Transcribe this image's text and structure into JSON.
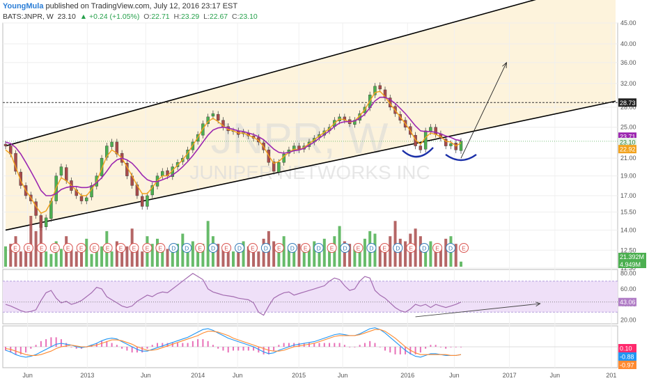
{
  "header": {
    "author": "YoungMula",
    "published": "published on TradingView.com, July 12, 2016 23:17 EST",
    "symbol": "BATS:JNPR, W",
    "last": "23.10",
    "change": "▲ +0.24 (+1.05%)",
    "open_label": "O:",
    "open": "22.71",
    "high_label": "H:",
    "high": "23.29",
    "low_label": "L:",
    "low": "22.67",
    "close_label": "C:",
    "close": "23.10"
  },
  "watermark": {
    "symbol": "JNPR, W",
    "company": "JUNIPER NETWORKS INC"
  },
  "colors": {
    "up": "#4caf50",
    "down": "#a84b4b",
    "ema": "#f2a21c",
    "sma": "#9c27b0",
    "channel_fill": "#fdf2d8",
    "rsi": "#a36bb0",
    "rsi_band": "#efe0f8",
    "macd": "#2196f3",
    "signal": "#ff8a30",
    "hist": "#e040a0",
    "arc": "#1a2fa8"
  },
  "chart_data": [
    {
      "type": "candlestick",
      "panel": "price",
      "x_ticks": [
        "Jun",
        "2013",
        "Jun",
        "2014",
        "Jun",
        "2015",
        "Jun",
        "2016",
        "Jun",
        "2017",
        "Jun",
        "201"
      ],
      "y_ticks": [
        "45.00",
        "40.00",
        "36.00",
        "32.00",
        "28.00",
        "25.00",
        "21.00",
        "19.00",
        "17.00",
        "15.50",
        "14.00",
        "12.50",
        "11.30"
      ],
      "ylim": [
        11.3,
        45
      ],
      "y_scale": "log",
      "series": [
        {
          "name": "Price",
          "values": [
            22.5,
            21.5,
            19.5,
            18.0,
            17.0,
            16.5,
            15.2,
            14.2,
            15.0,
            16.5,
            19.0,
            20.0,
            18.5,
            17.5,
            17.0,
            16.5,
            16.8,
            18.0,
            19.0,
            21.0,
            22.5,
            23.0,
            21.5,
            20.5,
            19.0,
            18.0,
            17.0,
            16.0,
            17.0,
            18.0,
            19.0,
            19.5,
            19.0,
            20.0,
            20.5,
            21.0,
            22.0,
            23.0,
            24.0,
            25.5,
            26.5,
            27.0,
            26.0,
            25.0,
            24.5,
            24.5,
            24.0,
            24.3,
            23.8,
            23.5,
            23.0,
            22.0,
            20.5,
            19.5,
            20.5,
            21.5,
            22.0,
            22.5,
            22.0,
            22.5,
            23.0,
            23.5,
            24.0,
            24.5,
            25.0,
            26.0,
            26.5,
            26.0,
            25.5,
            26.0,
            27.0,
            28.0,
            30.0,
            31.5,
            31.0,
            29.5,
            28.0,
            27.0,
            26.0,
            25.0,
            24.0,
            22.5,
            22.0,
            24.5,
            25.0,
            24.0,
            23.5,
            22.5,
            22.8,
            22.0,
            23.1
          ]
        },
        {
          "name": "EMA",
          "values": [
            22.0,
            21.5,
            20.0,
            18.5,
            17.5,
            16.8,
            16.0,
            15.4,
            15.6,
            16.4,
            17.8,
            18.8,
            18.5,
            18.0,
            17.5,
            17.0,
            17.0,
            17.6,
            18.4,
            19.8,
            21.2,
            22.0,
            21.6,
            21.0,
            20.0,
            19.0,
            18.0,
            17.2,
            17.2,
            17.8,
            18.5,
            19.0,
            19.0,
            19.6,
            20.2,
            20.8,
            21.6,
            22.6,
            23.6,
            24.8,
            25.8,
            26.3,
            25.8,
            25.2,
            24.7,
            24.5,
            24.2,
            24.2,
            23.9,
            23.6,
            23.2,
            22.4,
            21.3,
            20.4,
            20.6,
            21.2,
            21.7,
            22.1,
            22.0,
            22.3,
            22.8,
            23.3,
            23.8,
            24.3,
            24.8,
            25.6,
            26.2,
            26.1,
            25.7,
            25.9,
            26.7,
            27.6,
            29.0,
            30.4,
            30.6,
            29.7,
            28.5,
            27.5,
            26.5,
            25.5,
            24.5,
            23.3,
            22.7,
            23.6,
            24.2,
            24.0,
            23.7,
            23.1,
            23.0,
            22.5,
            22.9
          ]
        },
        {
          "name": "SMA",
          "values": [
            23.0,
            22.8,
            22.3,
            21.5,
            20.5,
            19.5,
            18.5,
            17.5,
            17.0,
            17.0,
            17.2,
            17.6,
            17.8,
            17.9,
            17.9,
            17.8,
            17.8,
            17.9,
            18.3,
            18.8,
            19.5,
            20.3,
            20.8,
            21.0,
            20.8,
            20.4,
            19.8,
            19.1,
            18.6,
            18.4,
            18.4,
            18.6,
            18.8,
            19.1,
            19.5,
            20.0,
            20.6,
            21.3,
            22.1,
            23.0,
            23.9,
            24.6,
            24.9,
            25.0,
            24.9,
            24.7,
            24.5,
            24.4,
            24.2,
            24.0,
            23.7,
            23.3,
            22.7,
            22.1,
            21.7,
            21.6,
            21.7,
            21.9,
            22.0,
            22.2,
            22.6,
            23.0,
            23.5,
            24.0,
            24.5,
            25.1,
            25.6,
            25.8,
            25.8,
            25.9,
            26.3,
            26.9,
            27.9,
            29.0,
            29.6,
            29.6,
            29.2,
            28.6,
            27.8,
            27.0,
            26.1,
            25.2,
            24.5,
            24.4,
            24.4,
            24.3,
            24.1,
            23.8,
            23.6,
            23.3,
            23.2
          ]
        }
      ],
      "price_labels": [
        {
          "text": "45.00"
        },
        {
          "text": "28.73"
        },
        {
          "text": "23.71"
        },
        {
          "text": "23.10"
        },
        {
          "text": "22.92"
        }
      ],
      "horizontal_line": 28.73,
      "channel": {
        "lower": [
          [
            0,
            14.0
          ],
          [
            88,
            23.8
          ],
          [
            100,
            25.6
          ]
        ],
        "upper": [
          [
            0,
            22.5
          ],
          [
            88,
            45.0
          ]
        ],
        "upper_offset_pct": 61
      },
      "arrow": {
        "from": [
          90,
          21.0
        ],
        "to": [
          99,
          36.0
        ]
      },
      "grid": true
    },
    {
      "type": "bar",
      "panel": "volume",
      "y_ticks": [
        "21.392M",
        "4.949M"
      ],
      "values": [
        8,
        9,
        12,
        6,
        7,
        20,
        14,
        18,
        6,
        5,
        10,
        7,
        12,
        8,
        6,
        9,
        11,
        5,
        7,
        8,
        14,
        6,
        10,
        9,
        8,
        15,
        7,
        6,
        12,
        9,
        11,
        8,
        7,
        6,
        9,
        13,
        8,
        10,
        7,
        9,
        18,
        12,
        9,
        8,
        7,
        6,
        9,
        10,
        8,
        7,
        6,
        11,
        14,
        10,
        8,
        12,
        7,
        6,
        9,
        8,
        7,
        10,
        9,
        11,
        8,
        12,
        16,
        10,
        9,
        8,
        7,
        11,
        14,
        13,
        8,
        9,
        12,
        18,
        11,
        10,
        13,
        15,
        12,
        9,
        10,
        8,
        7,
        11,
        12,
        9,
        2
      ],
      "earnings_markers": [
        "E",
        "E",
        "E",
        "E",
        "E",
        "E",
        "E",
        "E",
        "E",
        "E",
        "E",
        "E",
        "D",
        "D",
        "E",
        "D",
        "E",
        "D",
        "E",
        "D",
        "E",
        "D",
        "E",
        "D",
        "E",
        "D",
        "E",
        "D",
        "E",
        "D",
        "E",
        "D",
        "E",
        "D",
        "E"
      ]
    },
    {
      "type": "line",
      "panel": "rsi",
      "name": "RSI",
      "y_ticks": [
        "80.00",
        "60.00",
        "40.00",
        "20.00"
      ],
      "ylim": [
        15,
        85
      ],
      "band": [
        30,
        70
      ],
      "last_label": "43.06",
      "values": [
        40,
        38,
        35,
        32,
        30,
        31,
        33,
        45,
        55,
        58,
        48,
        42,
        44,
        40,
        42,
        45,
        50,
        55,
        62,
        60,
        50,
        46,
        42,
        38,
        36,
        38,
        44,
        48,
        52,
        50,
        54,
        56,
        55,
        60,
        65,
        70,
        75,
        80,
        76,
        72,
        60,
        56,
        54,
        52,
        51,
        50,
        48,
        47,
        46,
        42,
        30,
        26,
        38,
        48,
        52,
        55,
        56,
        52,
        54,
        56,
        58,
        60,
        62,
        64,
        70,
        74,
        72,
        64,
        58,
        60,
        70,
        76,
        74,
        58,
        52,
        48,
        42,
        36,
        32,
        30,
        34,
        40,
        38,
        40,
        36,
        40,
        38,
        36,
        38,
        40,
        43
      ],
      "trendline": {
        "from": [
          81,
          24
        ],
        "to": [
          96,
          41
        ]
      }
    },
    {
      "type": "line",
      "panel": "macd",
      "name": "MACD",
      "last_labels": [
        "0.10",
        "-0.88",
        "-0.97"
      ],
      "series": [
        {
          "name": "MACD",
          "values": [
            -0.4,
            -0.6,
            -0.9,
            -1.1,
            -1.2,
            -1.1,
            -0.9,
            -0.6,
            -0.3,
            0.0,
            0.3,
            0.4,
            0.3,
            0.2,
            0.0,
            -0.1,
            0.0,
            0.2,
            0.4,
            0.7,
            0.9,
            1.0,
            0.9,
            0.6,
            0.3,
            0.0,
            -0.3,
            -0.5,
            -0.5,
            -0.3,
            -0.1,
            0.1,
            0.3,
            0.5,
            0.7,
            0.9,
            1.1,
            1.4,
            1.7,
            2.0,
            2.1,
            1.9,
            1.6,
            1.3,
            1.0,
            0.8,
            0.6,
            0.4,
            0.2,
            0.0,
            -0.3,
            -0.6,
            -0.8,
            -0.7,
            -0.4,
            -0.2,
            0.0,
            0.2,
            0.3,
            0.4,
            0.5,
            0.6,
            0.8,
            1.0,
            1.2,
            1.4,
            1.5,
            1.4,
            1.3,
            1.3,
            1.5,
            1.8,
            2.1,
            2.2,
            2.0,
            1.6,
            1.1,
            0.6,
            0.1,
            -0.4,
            -0.8,
            -1.1,
            -1.2,
            -1.0,
            -0.8,
            -0.8,
            -0.9,
            -1.0,
            -1.0,
            -1.0,
            -0.9
          ]
        },
        {
          "name": "Signal",
          "values": [
            -0.2,
            -0.3,
            -0.5,
            -0.7,
            -0.9,
            -1.0,
            -1.0,
            -0.9,
            -0.7,
            -0.5,
            -0.2,
            0.0,
            0.1,
            0.2,
            0.1,
            0.0,
            0.0,
            0.1,
            0.2,
            0.4,
            0.6,
            0.8,
            0.8,
            0.7,
            0.5,
            0.3,
            0.0,
            -0.2,
            -0.4,
            -0.4,
            -0.3,
            -0.1,
            0.1,
            0.3,
            0.5,
            0.7,
            0.9,
            1.1,
            1.3,
            1.6,
            1.8,
            1.8,
            1.7,
            1.5,
            1.3,
            1.0,
            0.8,
            0.6,
            0.4,
            0.2,
            0.0,
            -0.2,
            -0.4,
            -0.5,
            -0.5,
            -0.4,
            -0.2,
            0.0,
            0.1,
            0.2,
            0.3,
            0.4,
            0.6,
            0.8,
            1.0,
            1.2,
            1.3,
            1.3,
            1.3,
            1.3,
            1.4,
            1.6,
            1.8,
            2.0,
            2.0,
            1.8,
            1.4,
            1.0,
            0.5,
            0.0,
            -0.4,
            -0.7,
            -0.9,
            -0.9,
            -0.9,
            -0.9,
            -0.9,
            -0.9,
            -1.0,
            -1.0,
            -0.9
          ]
        }
      ]
    }
  ]
}
